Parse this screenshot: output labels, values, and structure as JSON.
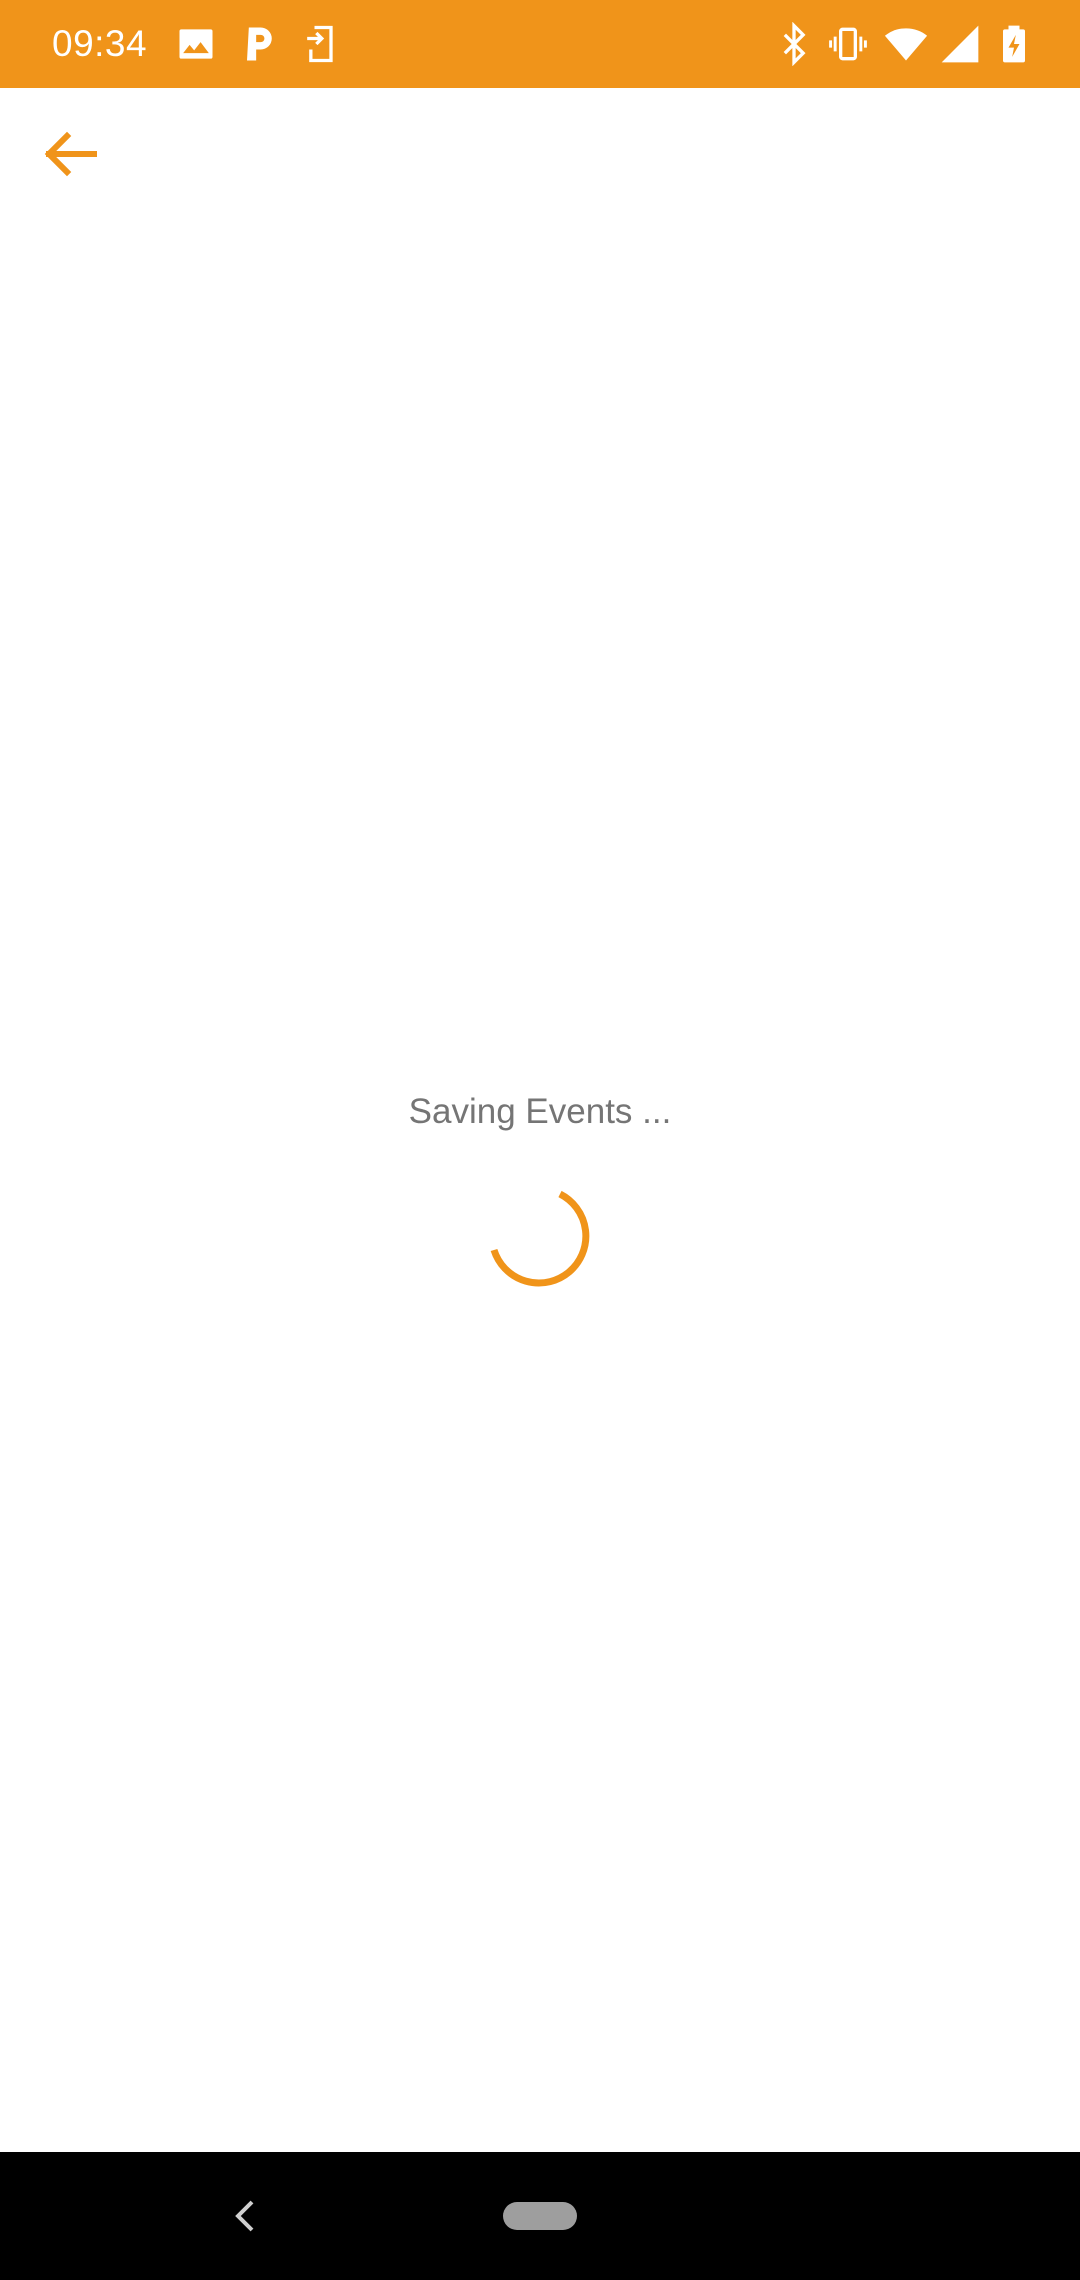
{
  "status_bar": {
    "time": "09:34",
    "background_color": "#F0941A",
    "left_icons": [
      "image-icon",
      "parking-app-icon",
      "screen-share-icon"
    ],
    "right_icons": [
      "bluetooth-icon",
      "vibrate-icon",
      "wifi-icon",
      "cell-signal-icon",
      "battery-charging-icon"
    ]
  },
  "app_bar": {
    "back_icon": "arrow-back-icon",
    "accent_color": "#F0941A"
  },
  "main": {
    "loading_text": "Saving Events ...",
    "spinner_color": "#F0941A",
    "text_color": "#757575"
  },
  "nav_bar": {
    "back_icon": "chevron-left-icon",
    "home_icon": "home-pill-icon"
  }
}
